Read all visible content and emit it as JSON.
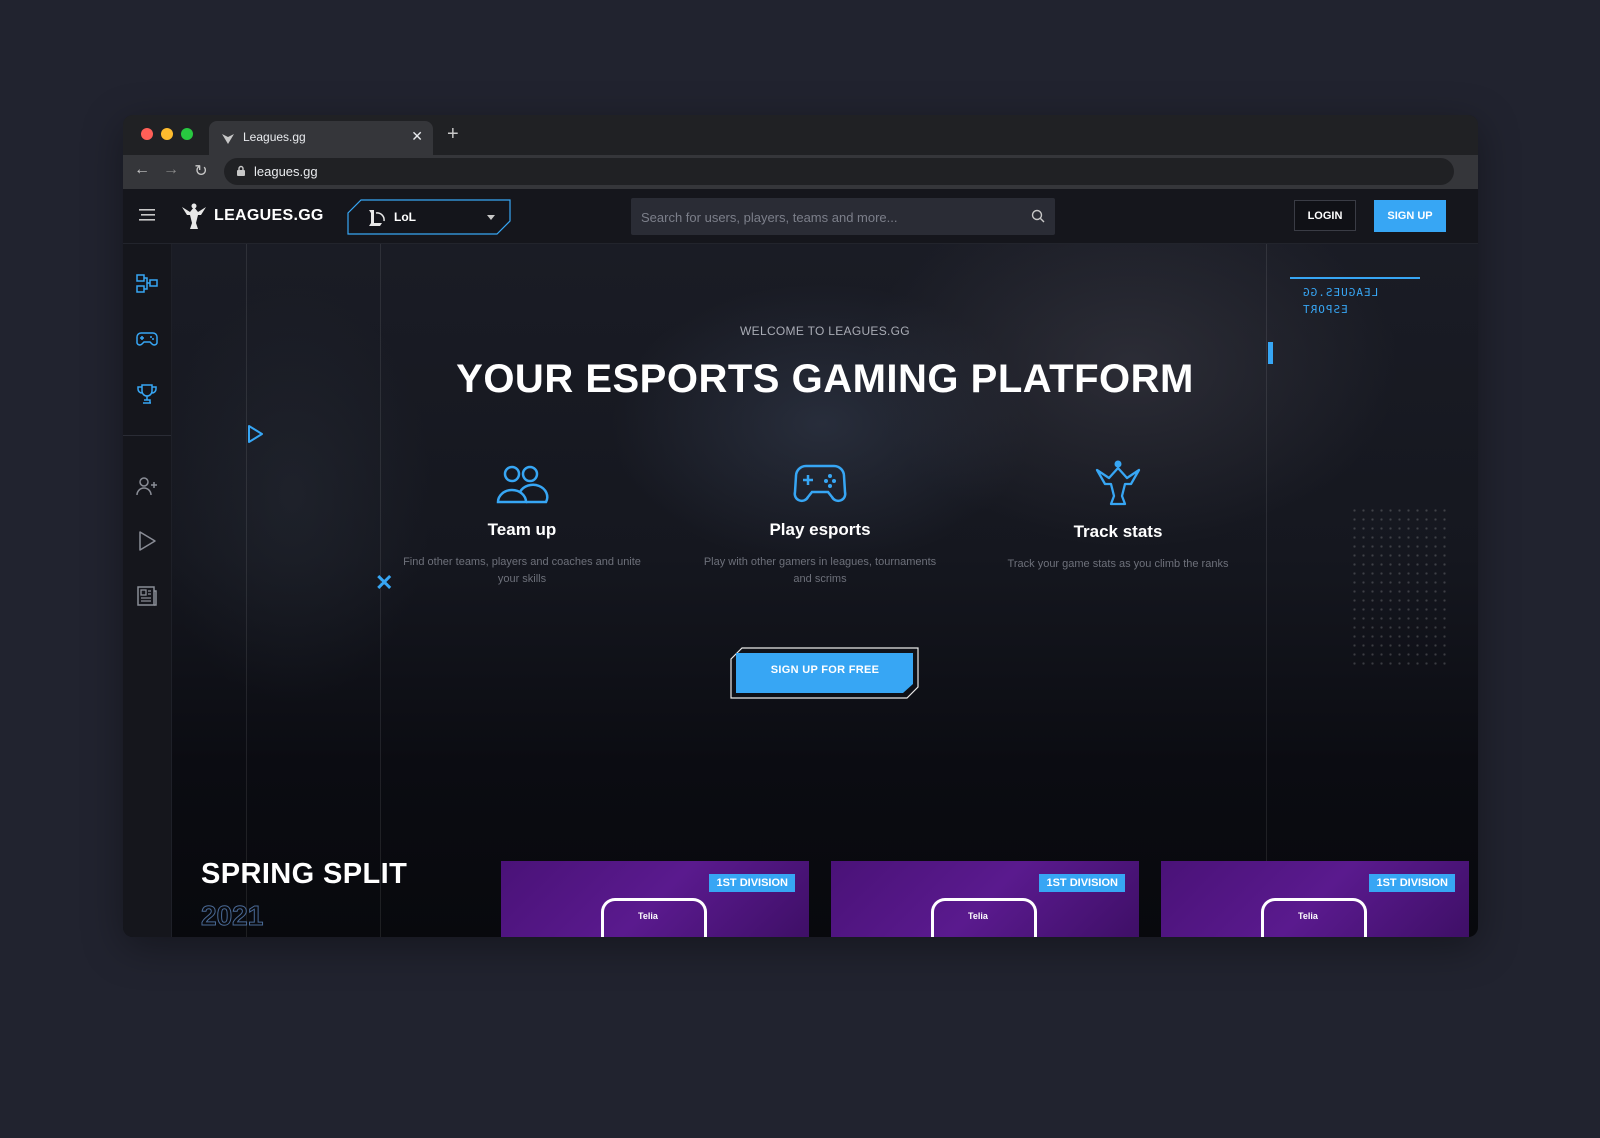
{
  "browser": {
    "tab_title": "Leagues.gg",
    "url": "leagues.gg"
  },
  "header": {
    "logo_text": "LEAGUES.GG",
    "game_selected": "LoL",
    "search_placeholder": "Search for users, players, teams and more...",
    "login_label": "LOGIN",
    "signup_label": "SIGN UP"
  },
  "sidebar": {
    "items": [
      {
        "icon": "brackets-icon"
      },
      {
        "icon": "gamepad-icon"
      },
      {
        "icon": "trophy-icon"
      },
      {
        "icon": "add-user-icon"
      },
      {
        "icon": "play-icon"
      },
      {
        "icon": "news-icon"
      }
    ]
  },
  "hero": {
    "welcome": "WELCOME TO LEAGUES.GG",
    "headline": "YOUR ESPORTS GAMING PLATFORM",
    "mirror_text_line1": "LEAGUES.GG",
    "mirror_text_line2": "ESPORT",
    "features": [
      {
        "icon": "team-icon",
        "title": "Team up",
        "description": "Find other teams, players and coaches and unite your skills"
      },
      {
        "icon": "controller-icon",
        "title": "Play esports",
        "description": "Play with other gamers in leagues, tournaments and scrims"
      },
      {
        "icon": "leagues-trophy-icon",
        "title": "Track stats",
        "description": "Track your game stats as you climb the ranks"
      }
    ],
    "cta_label": "SIGN UP FOR FREE"
  },
  "spring_split": {
    "title": "SPRING SPLIT",
    "year": "2021",
    "cards": [
      {
        "badge": "1ST DIVISION",
        "sponsor": "Telia"
      },
      {
        "badge": "1ST DIVISION",
        "sponsor": "Telia"
      },
      {
        "badge": "1ST DIVISION",
        "sponsor": "Telia"
      }
    ]
  },
  "colors": {
    "accent": "#37a6f4",
    "page_bg": "#21232f",
    "card_purple": "#4a1278"
  }
}
